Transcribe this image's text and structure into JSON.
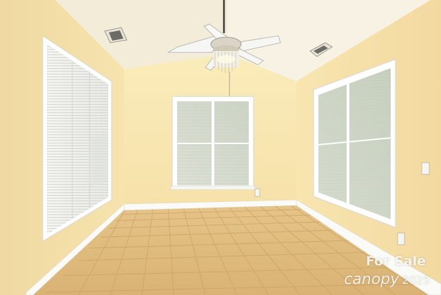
{
  "watermark": {
    "line1": "For Sale",
    "brand": "canopy",
    "year": "2025"
  }
}
